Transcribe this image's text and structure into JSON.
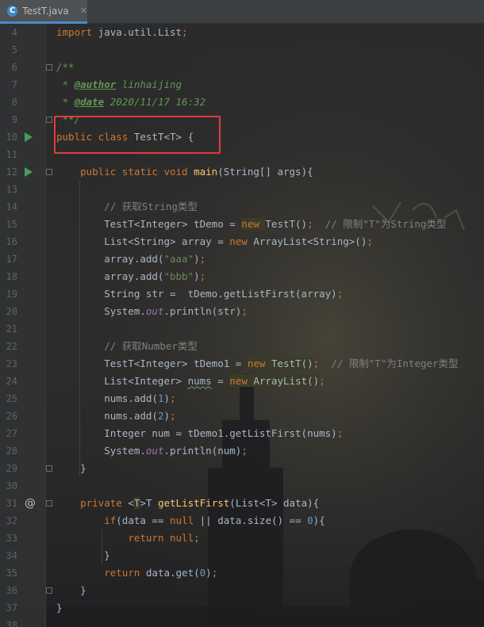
{
  "tab": {
    "title": "TestT.java",
    "icon": "c-class-icon",
    "close": "✕"
  },
  "lines": [
    {
      "n": "4",
      "segs": [
        [
          "kw",
          "import"
        ],
        [
          "t",
          " java.util.List"
        ],
        [
          "kw",
          ";"
        ]
      ]
    },
    {
      "n": "5",
      "segs": []
    },
    {
      "n": "6",
      "segs": [
        [
          "dc",
          "/**"
        ]
      ]
    },
    {
      "n": "7",
      "segs": [
        [
          "dc",
          " * "
        ],
        [
          "tag",
          "@author"
        ],
        [
          "dc",
          " linhaijing"
        ]
      ]
    },
    {
      "n": "8",
      "segs": [
        [
          "dc",
          " * "
        ],
        [
          "tag",
          "@date"
        ],
        [
          "dc",
          " 2020/11/17 16:32"
        ]
      ]
    },
    {
      "n": "9",
      "segs": [
        [
          "dc",
          " **/"
        ]
      ]
    },
    {
      "n": "10",
      "segs": [
        [
          "kw",
          "public class "
        ],
        [
          "t",
          "TestT<T> {"
        ]
      ]
    },
    {
      "n": "11",
      "segs": []
    },
    {
      "n": "12",
      "segs": [
        [
          "t",
          "    "
        ],
        [
          "kw",
          "public static void "
        ],
        [
          "fn",
          "main"
        ],
        [
          "t",
          "(String[] args){"
        ]
      ]
    },
    {
      "n": "13",
      "segs": []
    },
    {
      "n": "14",
      "segs": [
        [
          "cm",
          "        // 获取String类型"
        ]
      ]
    },
    {
      "n": "15",
      "segs": [
        [
          "t",
          "        TestT<Integer> tDemo = "
        ],
        [
          "kwh",
          "new "
        ],
        [
          "t",
          "TestT()"
        ],
        [
          "kw",
          ";"
        ],
        [
          "cm",
          "  // 限制\"T\"为String类型"
        ]
      ]
    },
    {
      "n": "16",
      "segs": [
        [
          "t",
          "        List<String> array = "
        ],
        [
          "kw",
          "new "
        ],
        [
          "t",
          "ArrayList<String>()"
        ],
        [
          "kw",
          ";"
        ]
      ]
    },
    {
      "n": "17",
      "segs": [
        [
          "t",
          "        array.add("
        ],
        [
          "st",
          "\"aaa\""
        ],
        [
          "t",
          ")"
        ],
        [
          "kw",
          ";"
        ]
      ]
    },
    {
      "n": "18",
      "segs": [
        [
          "t",
          "        array.add("
        ],
        [
          "st",
          "\"bbb\""
        ],
        [
          "t",
          ")"
        ],
        [
          "kw",
          ";"
        ]
      ]
    },
    {
      "n": "19",
      "segs": [
        [
          "t",
          "        String str =  tDemo.getListFirst(array)"
        ],
        [
          "kw",
          ";"
        ]
      ]
    },
    {
      "n": "20",
      "segs": [
        [
          "t",
          "        System."
        ],
        [
          "fd",
          "out"
        ],
        [
          "t",
          ".println(str)"
        ],
        [
          "kw",
          ";"
        ]
      ]
    },
    {
      "n": "21",
      "segs": []
    },
    {
      "n": "22",
      "segs": [
        [
          "cm",
          "        // 获取Number类型"
        ]
      ]
    },
    {
      "n": "23",
      "segs": [
        [
          "t",
          "        TestT<Integer> tDemo1 = "
        ],
        [
          "kwh",
          "new "
        ],
        [
          "th",
          "TestT()"
        ],
        [
          "kw",
          ";"
        ],
        [
          "cm",
          "  // 限制\"T\"为Integer类型"
        ]
      ]
    },
    {
      "n": "24",
      "segs": [
        [
          "t",
          "        List<Integer> "
        ],
        [
          "ul",
          "nums"
        ],
        [
          "t",
          " = "
        ],
        [
          "kwh",
          "new "
        ],
        [
          "th",
          "ArrayList()"
        ],
        [
          "kw",
          ";"
        ]
      ]
    },
    {
      "n": "25",
      "segs": [
        [
          "t",
          "        nums.add("
        ],
        [
          "nm",
          "1"
        ],
        [
          "t",
          ")"
        ],
        [
          "kw",
          ";"
        ]
      ]
    },
    {
      "n": "26",
      "segs": [
        [
          "t",
          "        nums.add("
        ],
        [
          "nm",
          "2"
        ],
        [
          "t",
          ")"
        ],
        [
          "kw",
          ";"
        ]
      ]
    },
    {
      "n": "27",
      "segs": [
        [
          "t",
          "        Integer num = tDemo1.getListFirst(nums)"
        ],
        [
          "kw",
          ";"
        ]
      ]
    },
    {
      "n": "28",
      "segs": [
        [
          "t",
          "        System."
        ],
        [
          "fd",
          "out"
        ],
        [
          "t",
          ".println(num)"
        ],
        [
          "kw",
          ";"
        ]
      ]
    },
    {
      "n": "29",
      "segs": [
        [
          "t",
          "    }"
        ]
      ]
    },
    {
      "n": "30",
      "segs": []
    },
    {
      "n": "31",
      "segs": [
        [
          "t",
          "    "
        ],
        [
          "kw",
          "private "
        ],
        [
          "t",
          "<"
        ],
        [
          "th",
          "T"
        ],
        [
          "t",
          ">T "
        ],
        [
          "fn",
          "getListFirst"
        ],
        [
          "t",
          "(List<T> data){"
        ]
      ]
    },
    {
      "n": "32",
      "segs": [
        [
          "t",
          "        "
        ],
        [
          "kw",
          "if"
        ],
        [
          "t",
          "(data == "
        ],
        [
          "kw",
          "null "
        ],
        [
          "t",
          "|| data.size() == "
        ],
        [
          "nm",
          "0"
        ],
        [
          "t",
          "){"
        ]
      ]
    },
    {
      "n": "33",
      "segs": [
        [
          "t",
          "            "
        ],
        [
          "kw",
          "return null;"
        ]
      ]
    },
    {
      "n": "34",
      "segs": [
        [
          "t",
          "        }"
        ]
      ]
    },
    {
      "n": "35",
      "segs": [
        [
          "t",
          "        "
        ],
        [
          "kw",
          "return "
        ],
        [
          "t",
          "data.get("
        ],
        [
          "nm",
          "0"
        ],
        [
          "t",
          ")"
        ],
        [
          "kw",
          ";"
        ]
      ]
    },
    {
      "n": "36",
      "segs": [
        [
          "t",
          "    }"
        ]
      ]
    },
    {
      "n": "37",
      "segs": [
        [
          "t",
          "}"
        ]
      ]
    },
    {
      "n": "38",
      "segs": []
    }
  ],
  "gutter_marks": {
    "10": "run-icon",
    "12": "run-icon",
    "31": "override-at-icon"
  },
  "at_glyph": "@"
}
